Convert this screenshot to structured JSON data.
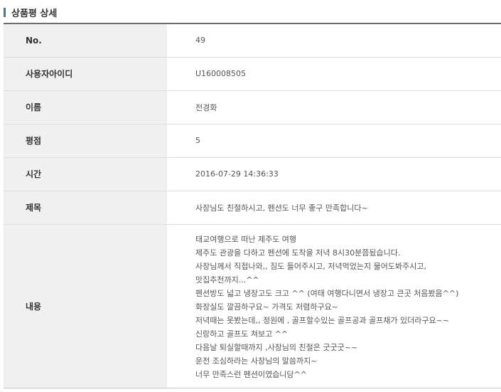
{
  "section": {
    "title": "상품평 상세"
  },
  "rows": [
    {
      "label": "No.",
      "value": "49"
    },
    {
      "label": "사용자아이디",
      "value": "U160008505"
    },
    {
      "label": "이름",
      "value": "전경화"
    },
    {
      "label": "평점",
      "value": "5"
    },
    {
      "label": "시간",
      "value": "2016-07-29 14:36:33"
    },
    {
      "label": "제목",
      "value": "사장님도 친절하시고, 펜션도 너무 좋구 만족합니다~"
    }
  ],
  "content": {
    "label": "내용",
    "lines": [
      "태교여행으로 떠난 제주도 여행",
      "제주도 관광을 다하고 펜션에 도착을 저녁 8시30분쯤됬습니다.",
      "사장님께서 직접나와,, 짐도 들어주시고, 저녁먹었는지 물어도봐주시고,",
      "맛집추천까지...^^",
      "펜션방도 넓고 냉장고도 크고 ^^ (여태 여행다니면서 냉장고 큰곳 처음봤음^^)",
      "화장실도 깔끔하구요~ 가격도 저렴하구요~",
      "저녁때는 못봤는데,, 정원에 , 골프할수있는 골프공과 골프채가 있더라구요~~",
      "신랑하고 골프도 쳐보고 ^^",
      "다음날 퇴실할때까지 ,사장님의 친절은 굿굿굿~~",
      "운전 조심하라는 사장님의 말씀까지~",
      "너무 만족스런 펜션이였습니당^^"
    ]
  },
  "colors": {
    "accent_bar": "#2f79c7",
    "label_bg": "#f0f0f0"
  }
}
